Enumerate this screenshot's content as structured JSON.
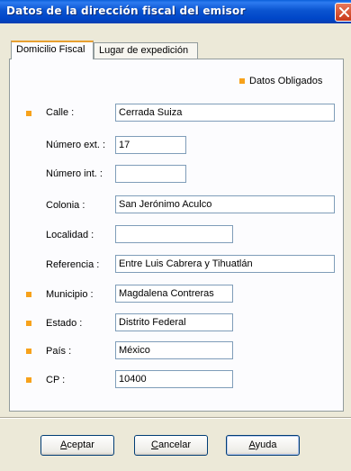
{
  "window": {
    "title": "Datos de la dirección fiscal del emisor"
  },
  "tabs": [
    {
      "label": "Domicilio Fiscal"
    },
    {
      "label": "Lugar de expedición"
    }
  ],
  "legend": {
    "label": "Datos Obligados"
  },
  "colors": {
    "required_marker": "#f7a21b",
    "title_bar": "#0a54d0"
  },
  "fields": [
    {
      "label": "Calle :",
      "value": "Cerrada Suiza",
      "required": true
    },
    {
      "label": "Número ext. :",
      "value": "17",
      "required": false
    },
    {
      "label": "Número int. :",
      "value": "",
      "required": false
    },
    {
      "label": "Colonia :",
      "value": "San Jerónimo Aculco",
      "required": false
    },
    {
      "label": "Localidad :",
      "value": "",
      "required": false
    },
    {
      "label": "Referencia :",
      "value": "Entre Luis Cabrera y Tihuatlán",
      "required": false
    },
    {
      "label": "Municipio :",
      "value": "Magdalena Contreras",
      "required": true
    },
    {
      "label": "Estado :",
      "value": "Distrito Federal",
      "required": true
    },
    {
      "label": "País :",
      "value": "México",
      "required": true
    },
    {
      "label": "CP :",
      "value": "10400",
      "required": true
    }
  ],
  "buttons": {
    "accept_first": "A",
    "accept_rest": "ceptar",
    "cancel_first": "C",
    "cancel_rest": "ancelar",
    "help_first": "A",
    "help_rest": "yuda"
  }
}
